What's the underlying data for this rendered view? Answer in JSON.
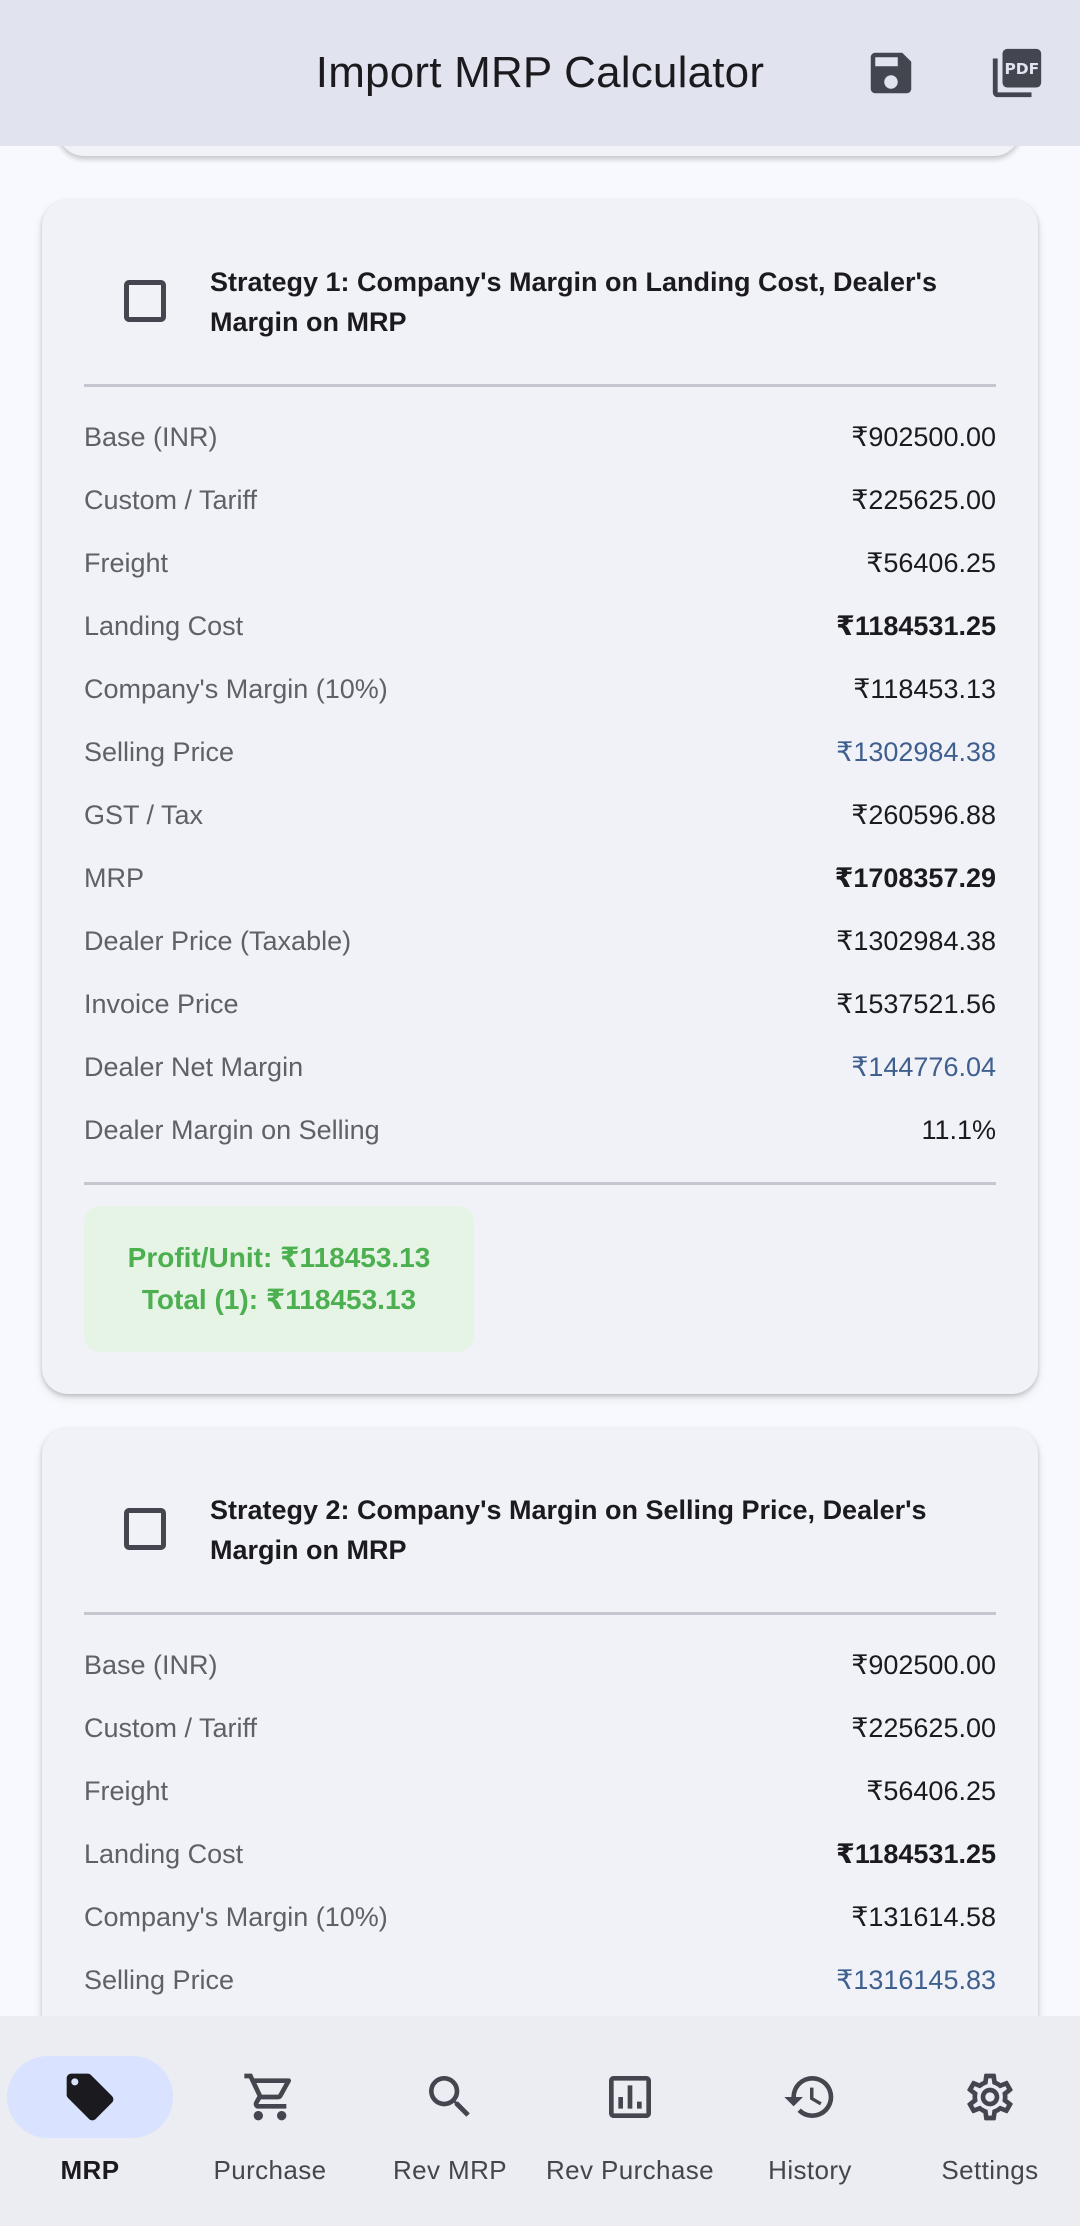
{
  "app": {
    "title": "Import MRP Calculator"
  },
  "toolbar": {
    "save_icon": "save-icon",
    "pdf_icon": "pdf-icon",
    "pdf_icon_text": "PDF"
  },
  "strategies": [
    {
      "title": "Strategy 1: Company's Margin on Landing Cost, Dealer's Margin on MRP",
      "checked": false,
      "rows": [
        {
          "label": "Base (INR)",
          "value": "₹902500.00"
        },
        {
          "label": "Custom / Tariff",
          "value": "₹225625.00"
        },
        {
          "label": "Freight",
          "value": "₹56406.25"
        },
        {
          "label": "Landing Cost",
          "value": "₹1184531.25"
        },
        {
          "label": "Company's Margin (10%)",
          "value": "₹118453.13"
        },
        {
          "label": "Selling Price",
          "value": "₹1302984.38"
        },
        {
          "label": "GST / Tax",
          "value": "₹260596.88"
        },
        {
          "label": "MRP",
          "value": "₹1708357.29"
        },
        {
          "label": "Dealer Price (Taxable)",
          "value": "₹1302984.38"
        },
        {
          "label": "Invoice Price",
          "value": "₹1537521.56"
        },
        {
          "label": "Dealer Net Margin",
          "value": "₹144776.04"
        },
        {
          "label": "Dealer Margin on Selling",
          "value": "11.1%"
        }
      ],
      "profit_unit": "Profit/Unit: ₹118453.13",
      "profit_total": "Total (1): ₹118453.13"
    },
    {
      "title": "Strategy 2: Company's Margin on Selling Price, Dealer's Margin on MRP",
      "checked": false,
      "rows": [
        {
          "label": "Base (INR)",
          "value": "₹902500.00"
        },
        {
          "label": "Custom / Tariff",
          "value": "₹225625.00"
        },
        {
          "label": "Freight",
          "value": "₹56406.25"
        },
        {
          "label": "Landing Cost",
          "value": "₹1184531.25"
        },
        {
          "label": "Company's Margin (10%)",
          "value": "₹131614.58"
        },
        {
          "label": "Selling Price",
          "value": "₹1316145.83"
        }
      ]
    }
  ],
  "colors": {
    "appbar_bg": "#e1e3ee",
    "accent_blue": "#3f5f8f",
    "profit_green": "#4caf50",
    "profit_bg": "#e6f4e6",
    "nav_active_bg": "#d9e2ff"
  },
  "bottom_nav": {
    "items": [
      {
        "label": "MRP",
        "icon": "tag-icon",
        "active": true
      },
      {
        "label": "Purchase",
        "icon": "cart-icon",
        "active": false
      },
      {
        "label": "Rev MRP",
        "icon": "search-icon",
        "active": false
      },
      {
        "label": "Rev Purchase",
        "icon": "chart-icon",
        "active": false
      },
      {
        "label": "History",
        "icon": "history-icon",
        "active": false
      },
      {
        "label": "Settings",
        "icon": "gear-icon",
        "active": false
      }
    ]
  }
}
